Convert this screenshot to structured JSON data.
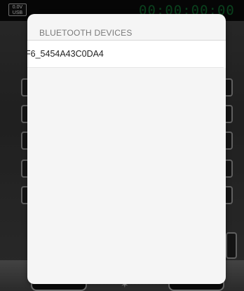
{
  "status_bar": {
    "battery_voltage": "0.0V",
    "battery_source": "USB",
    "timer": "00:00:00:00"
  },
  "dialog": {
    "title": "BLUETOOTH DEVICES",
    "devices": [
      {
        "name": "F6_5454A43C0DA4"
      }
    ]
  },
  "colors": {
    "timer": "#0f5e2a",
    "dialog_bg": "#f5f5f5",
    "title_text": "#7a7a7a"
  },
  "icons": {
    "tray_center": "bluetooth-icon"
  }
}
